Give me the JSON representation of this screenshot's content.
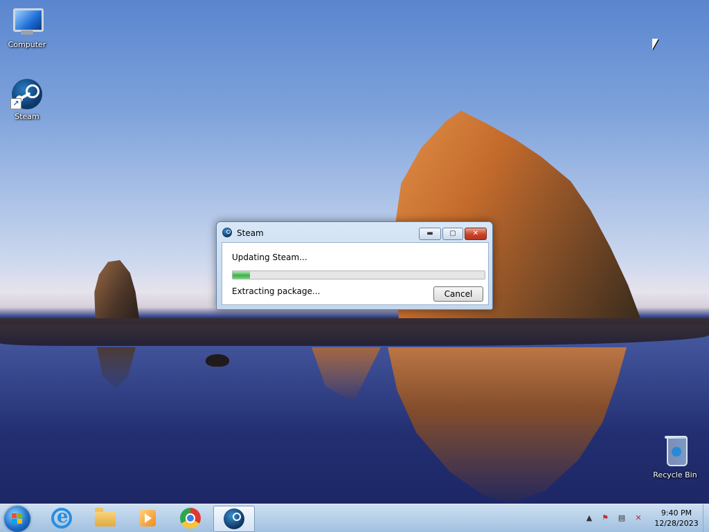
{
  "desktop": {
    "icons": [
      {
        "label": "Computer",
        "icon": "computer-icon"
      },
      {
        "label": "Steam",
        "icon": "steam-icon"
      },
      {
        "label": "Recycle Bin",
        "icon": "recycle-bin-icon"
      }
    ]
  },
  "window": {
    "title": "Steam",
    "status_line": "Updating Steam...",
    "detail_line": "Extracting package...",
    "progress": 0.07,
    "cancel_label": "Cancel",
    "accent_color": "#37b346"
  },
  "taskbar": {
    "pinned": [
      {
        "name": "internet-explorer",
        "icon": "internet-explorer-icon"
      },
      {
        "name": "file-explorer",
        "icon": "folder-icon"
      },
      {
        "name": "media-player",
        "icon": "media-player-icon"
      },
      {
        "name": "chrome",
        "icon": "chrome-icon"
      },
      {
        "name": "steam",
        "icon": "steam-icon",
        "active": true
      }
    ],
    "tray": {
      "time": "9:40 PM",
      "date": "12/28/2023",
      "icons": [
        "show-hidden-icons-arrow",
        "action-center-flag-icon",
        "network-icon",
        "volume-muted-icon"
      ]
    }
  }
}
